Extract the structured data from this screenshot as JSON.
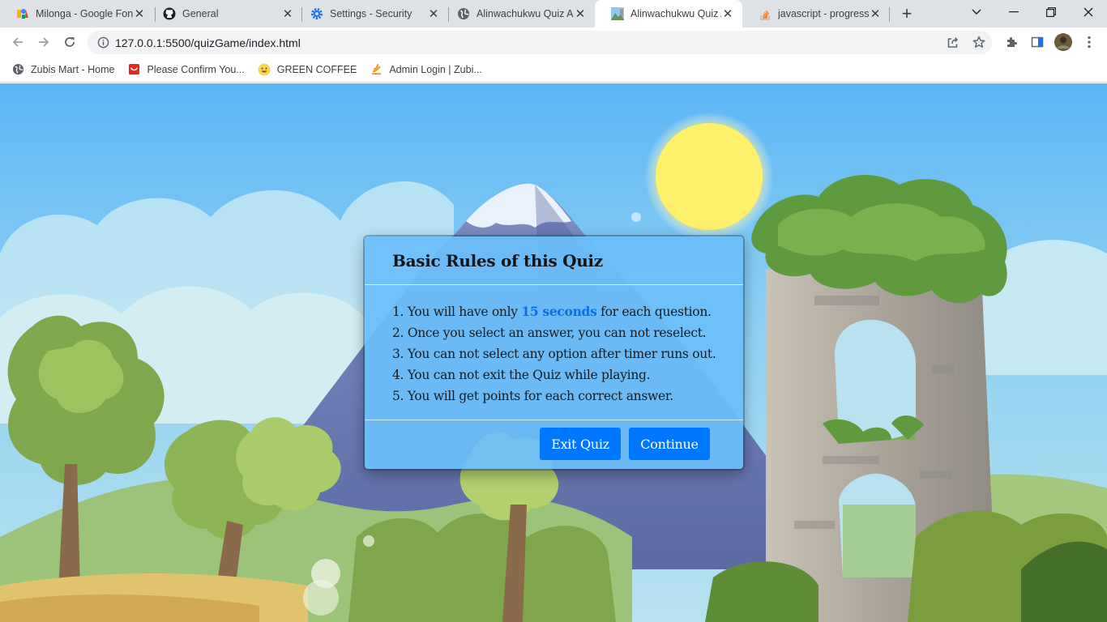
{
  "browser": {
    "tabs": [
      {
        "title": "Milonga - Google Fon",
        "icon": "google-fonts-icon"
      },
      {
        "title": "General",
        "icon": "github-icon"
      },
      {
        "title": "Settings - Security",
        "icon": "settings-gear-icon"
      },
      {
        "title": "Alinwachukwu Quiz A",
        "icon": "globe-icon"
      },
      {
        "title": "Alinwachukwu Quiz A",
        "icon": "page-thumbnail-icon",
        "active": true
      },
      {
        "title": "javascript - progress b",
        "icon": "stackoverflow-icon"
      }
    ],
    "url": "127.0.0.1:5500/quizGame/index.html",
    "bookmarks": [
      {
        "label": "Zubis Mart - Home",
        "icon": "globe-icon"
      },
      {
        "label": "Please Confirm You...",
        "icon": "red-bag-icon"
      },
      {
        "label": "GREEN COFFEE",
        "icon": "smiley-icon"
      },
      {
        "label": "Admin Login | Zubi...",
        "icon": "flame-icon"
      }
    ]
  },
  "dialog": {
    "title": "Basic Rules of this Quiz",
    "rules": [
      {
        "prefix": "1. You will have only ",
        "highlight": "15 seconds",
        "suffix": " for each question."
      },
      {
        "text": "2. Once you select an answer, you can not reselect."
      },
      {
        "text": "3. You can not select any option after timer runs out."
      },
      {
        "text": "4. You can not exit the Quiz while playing."
      },
      {
        "text": "5. You will get points for each correct answer."
      }
    ],
    "exit_label": "Exit Quiz",
    "continue_label": "Continue"
  },
  "colors": {
    "sky": "#5fb8f5",
    "dialog_bg": "#6cbefa",
    "button": "#0077ff",
    "highlight": "#0b6ee6"
  }
}
